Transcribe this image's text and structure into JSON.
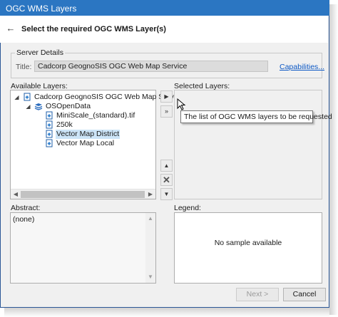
{
  "window": {
    "title": "OGC WMS Layers"
  },
  "header": {
    "step_title": "Select the required OGC WMS Layer(s)"
  },
  "server": {
    "group_label": "Server Details",
    "title_label": "Title:",
    "title_value": "Cadcorp GeognoSIS OGC Web Map Service",
    "capabilities_link": "Capabilities..."
  },
  "available": {
    "label": "Available Layers:",
    "tree": [
      {
        "label": "Cadcorp GeognoSIS OGC Web Map Service",
        "level": 0,
        "expanded": true,
        "icon": "layer-doc-icon"
      },
      {
        "label": "OSOpenData",
        "level": 1,
        "expanded": true,
        "icon": "layers-stack-icon"
      },
      {
        "label": "MiniScale_(standard).tif",
        "level": 2,
        "icon": "layer-doc-icon"
      },
      {
        "label": "250k",
        "level": 2,
        "icon": "layer-doc-icon"
      },
      {
        "label": "Vector Map District",
        "level": 2,
        "icon": "layer-doc-icon",
        "selected": true
      },
      {
        "label": "Vector Map Local",
        "level": 2,
        "icon": "layer-doc-icon"
      }
    ]
  },
  "selected": {
    "label": "Selected Layers:",
    "tooltip": "The list of OGC WMS layers to be requested"
  },
  "abstract": {
    "label": "Abstract:",
    "value": "(none)"
  },
  "legend": {
    "label": "Legend:",
    "placeholder": "No sample available"
  },
  "footer": {
    "next_label": "Next >",
    "cancel_label": "Cancel"
  },
  "colors": {
    "title_bar": "#2b76c2",
    "link": "#0b57c4",
    "selection": "#cce4f7"
  }
}
